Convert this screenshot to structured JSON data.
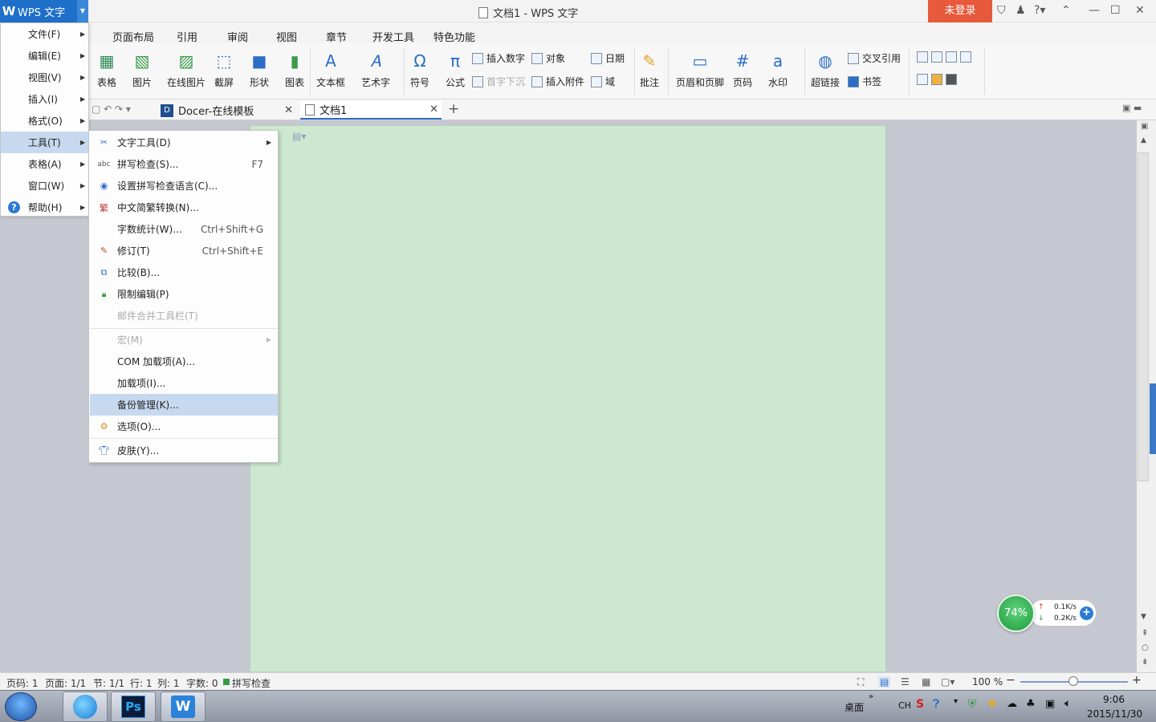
{
  "app": {
    "menu_button": "WPS 文字",
    "window_title": "文档1 - WPS 文字",
    "login": "未登录"
  },
  "ribbon_tabs": [
    "页面布局",
    "引用",
    "审阅",
    "视图",
    "章节",
    "开发工具",
    "特色功能"
  ],
  "ribbon": {
    "table": "表格",
    "picture": "图片",
    "online_picture": "在线图片",
    "screenshot": "截屏",
    "shape": "形状",
    "chart": "图表",
    "textbox": "文本框",
    "wordart": "艺术字",
    "symbol": "符号",
    "formula": "公式",
    "insert_number": "插入数字",
    "dropcap": "首字下沉",
    "object": "对象",
    "insert_attachment": "插入附件",
    "date": "日期",
    "field": "域",
    "comment": "批注",
    "header_footer": "页眉和页脚",
    "page_number": "页码",
    "watermark": "水印",
    "hyperlink": "超链接",
    "cross_ref": "交叉引用",
    "bookmark": "书签"
  },
  "doc_tabs": [
    "Docer-在线模板",
    "文档1"
  ],
  "main_menu": [
    {
      "label": "文件(F)"
    },
    {
      "label": "编辑(E)"
    },
    {
      "label": "视图(V)"
    },
    {
      "label": "插入(I)"
    },
    {
      "label": "格式(O)"
    },
    {
      "label": "工具(T)"
    },
    {
      "label": "表格(A)"
    },
    {
      "label": "窗口(W)"
    },
    {
      "label": "帮助(H)"
    }
  ],
  "tools_menu": [
    {
      "label": "文字工具(D)",
      "shortcut": ""
    },
    {
      "label": "拼写检查(S)...",
      "shortcut": "F7"
    },
    {
      "label": "设置拼写检查语言(C)...",
      "shortcut": ""
    },
    {
      "label": "中文简繁转换(N)...",
      "shortcut": ""
    },
    {
      "label": "字数统计(W)...",
      "shortcut": "Ctrl+Shift+G"
    },
    {
      "label": "修订(T)",
      "shortcut": "Ctrl+Shift+E"
    },
    {
      "label": "比较(B)...",
      "shortcut": ""
    },
    {
      "label": "限制编辑(P)",
      "shortcut": ""
    },
    {
      "label": "邮件合并工具栏(T)",
      "shortcut": ""
    },
    {
      "label": "宏(M)",
      "shortcut": ""
    },
    {
      "label": "COM 加载项(A)...",
      "shortcut": ""
    },
    {
      "label": "加载项(I)...",
      "shortcut": ""
    },
    {
      "label": "备份管理(K)...",
      "shortcut": ""
    },
    {
      "label": "选项(O)...",
      "shortcut": ""
    },
    {
      "label": "皮肤(Y)...",
      "shortcut": ""
    }
  ],
  "status": {
    "page": "页码: 1",
    "pages": "页面: 1/1",
    "section": "节: 1/1",
    "row": "行: 1",
    "col": "列: 1",
    "words": "字数: 0",
    "spell": "拼写检查",
    "zoom": "100 %"
  },
  "network": {
    "percent": "74%",
    "up": "0.1K/s",
    "down": "0.2K/s"
  },
  "taskbar": {
    "desktop": "桌面",
    "lang": "CH",
    "time": "9:06",
    "date": "2015/11/30"
  }
}
